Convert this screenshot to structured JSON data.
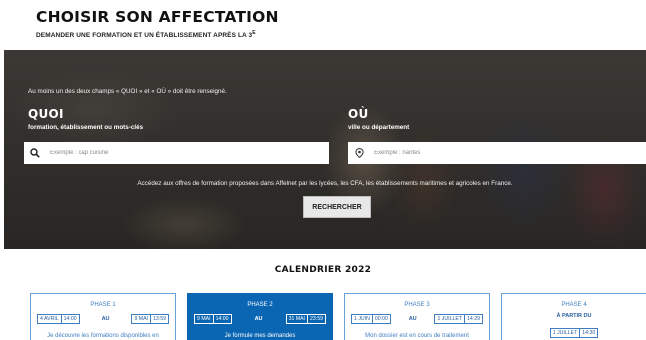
{
  "header": {
    "title": "CHOISIR SON AFFECTATION",
    "subtitle": "DEMANDER UNE FORMATION ET UN ÉTABLISSEMENT APRÈS LA 3",
    "subtitle_sup": "E"
  },
  "search": {
    "notice": "Au moins un des deux champs « QUOI » et « OÙ » doit être renseigné.",
    "quoi": {
      "title": "QUOI",
      "subtitle": "formation, établissement ou mots-clés",
      "placeholder": "Exemple : cap cuisine"
    },
    "ou": {
      "title": "OÙ",
      "subtitle": "ville ou département",
      "placeholder": "Exemple : nantes"
    },
    "info": "Accédez aux offres de formation proposées dans Affelnet par les lycées, les CFA, les établissements maritimes et agricoles en France.",
    "button_label": "RECHERCHER"
  },
  "calendar": {
    "title": "CALENDRIER 2022",
    "au_label": "AU",
    "phases": [
      {
        "title": "PHASE 1",
        "start_date": "4 AVRIL",
        "start_time": "14:00",
        "end_date": "9 MAI",
        "end_time": "13:59",
        "description": "Je découvre les formations disponibles en"
      },
      {
        "title": "PHASE 2",
        "start_date": "9 MAI",
        "start_time": "14:00",
        "end_date": "31 MAI",
        "end_time": "23:59",
        "description": "Je formule mes demandes"
      },
      {
        "title": "PHASE 3",
        "start_date": "1 JUIN",
        "start_time": "00:00",
        "end_date": "1 JUILLET",
        "end_time": "14:29",
        "description": "Mon dossier est en cours de traitement"
      },
      {
        "title": "PHASE 4",
        "from_label": "À PARTIR DU",
        "start_date": "1 JUILLET",
        "start_time": "14:30"
      }
    ]
  },
  "colors": {
    "accent": "#0a66b2",
    "phase_border": "#69a2d6",
    "phase_text": "#3f7fc1"
  }
}
